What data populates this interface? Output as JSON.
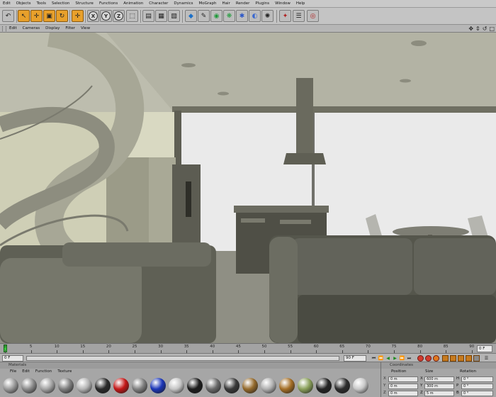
{
  "menubar": {
    "items": [
      "Edit",
      "Objects",
      "Tools",
      "Selection",
      "Structure",
      "Functions",
      "Animation",
      "Character",
      "Dynamics",
      "MoGraph",
      "Hair",
      "Render",
      "Plugins",
      "Window",
      "Help"
    ]
  },
  "toolbar": {
    "icons": [
      "undo-icon",
      "select-icon",
      "move-icon",
      "scale-icon",
      "rotate-icon",
      "live-select-icon",
      "x-axis-lock-icon",
      "y-axis-lock-icon",
      "z-axis-lock-icon",
      "coordinate-system-icon",
      "render-view-icon",
      "render-picture-viewer-icon",
      "render-settings-icon",
      "cube-object-icon",
      "spline-pen-icon",
      "nurbs-icon",
      "array-icon",
      "deformer-icon",
      "scene-object-icon",
      "camera-icon",
      "light-icon",
      "preferences-icon",
      "render-queue-icon"
    ],
    "axis_labels": [
      "X",
      "Y",
      "Z"
    ]
  },
  "viewport": {
    "menu": [
      "Edit",
      "Cameras",
      "Display",
      "Filter",
      "View"
    ]
  },
  "timeline": {
    "ticks": [
      "0",
      "5",
      "10",
      "15",
      "20",
      "25",
      "30",
      "35",
      "40",
      "45",
      "50",
      "55",
      "60",
      "65",
      "70",
      "75",
      "80",
      "85",
      "90"
    ],
    "current_frame": "0 F"
  },
  "transport": {
    "start_field": "0 F",
    "end_field": "90 F"
  },
  "materials": {
    "title": "Materials",
    "menu": [
      "File",
      "Edit",
      "Function",
      "Texture"
    ],
    "swatches": [
      {
        "name": "material-swatch-1",
        "color": "#9a9a9a"
      },
      {
        "name": "material-swatch-2",
        "color": "#8b8b8b"
      },
      {
        "name": "material-swatch-3",
        "color": "#a4a4a4"
      },
      {
        "name": "material-swatch-4",
        "color": "#7e7e7e"
      },
      {
        "name": "material-swatch-5",
        "color": "#b4b4b4"
      },
      {
        "name": "material-swatch-6",
        "color": "#2a2a2a"
      },
      {
        "name": "material-swatch-7",
        "color": "#c41818"
      },
      {
        "name": "material-swatch-8",
        "color": "#808080"
      },
      {
        "name": "material-swatch-9",
        "color": "#1b36b8"
      },
      {
        "name": "material-swatch-10",
        "color": "#c5c5c5"
      },
      {
        "name": "material-swatch-11",
        "color": "#1c1c1c"
      },
      {
        "name": "material-swatch-12",
        "color": "#6a6a6a"
      },
      {
        "name": "material-swatch-13",
        "color": "#3a3a3a"
      },
      {
        "name": "material-swatch-14",
        "color": "#946a2c"
      },
      {
        "name": "material-swatch-15",
        "color": "#b0b0b0"
      },
      {
        "name": "material-swatch-16",
        "color": "#a56f26"
      },
      {
        "name": "material-swatch-17",
        "color": "#8aa05a"
      },
      {
        "name": "material-swatch-18",
        "color": "#242424"
      },
      {
        "name": "material-swatch-19",
        "color": "#2d2d2d"
      },
      {
        "name": "material-swatch-20",
        "color": "#c8c8c8"
      }
    ]
  },
  "coordinates": {
    "title": "Coordinates",
    "headers": [
      "Position",
      "Size",
      "Rotation"
    ],
    "rows": [
      {
        "axis": "X",
        "position": "0 m",
        "size_axis": "X",
        "size": "600 m",
        "rot_axis": "H",
        "rotation": "0 °"
      },
      {
        "axis": "Y",
        "position": "0 m",
        "size_axis": "Y",
        "size": "300 m",
        "rot_axis": "P",
        "rotation": "0 °"
      },
      {
        "axis": "Z",
        "position": "0 m",
        "size_axis": "Z",
        "size": "5 m",
        "rot_axis": "B",
        "rotation": "0 °"
      }
    ]
  }
}
